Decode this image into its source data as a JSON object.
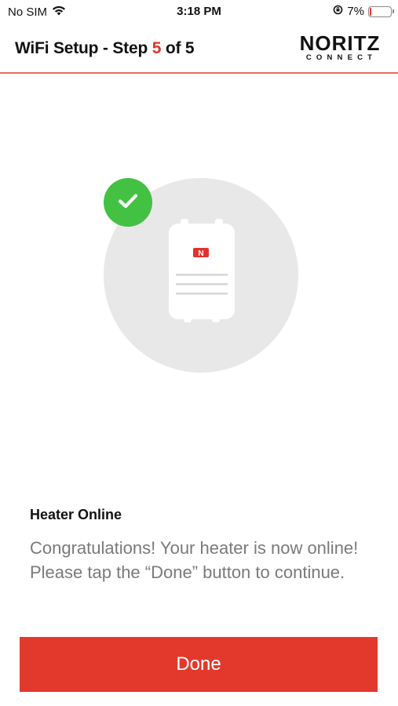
{
  "status_bar": {
    "carrier": "No SIM",
    "time": "3:18 PM",
    "battery_percent": "7%",
    "battery_level": 0.07,
    "icons": [
      "wifi-icon",
      "orientation-lock-icon",
      "battery-icon"
    ]
  },
  "header": {
    "title_prefix": "WiFi Setup - Step",
    "step_current": "5",
    "step_suffix": "of 5",
    "logo_main": "NORITZ",
    "logo_sub": "CONNECT"
  },
  "illustration": {
    "icons": [
      "checkmark-icon",
      "water-heater-icon"
    ],
    "badge_color": "#43c143",
    "brand_mark": "N"
  },
  "content": {
    "title": "Heater Online",
    "body": "Congratulations! Your heater is now online! Please tap the “Done” button to continue."
  },
  "actions": {
    "done_label": "Done"
  },
  "colors": {
    "accent": "#e3392d",
    "header_rule": "#e56b66",
    "body_text": "#7a7a7a"
  }
}
